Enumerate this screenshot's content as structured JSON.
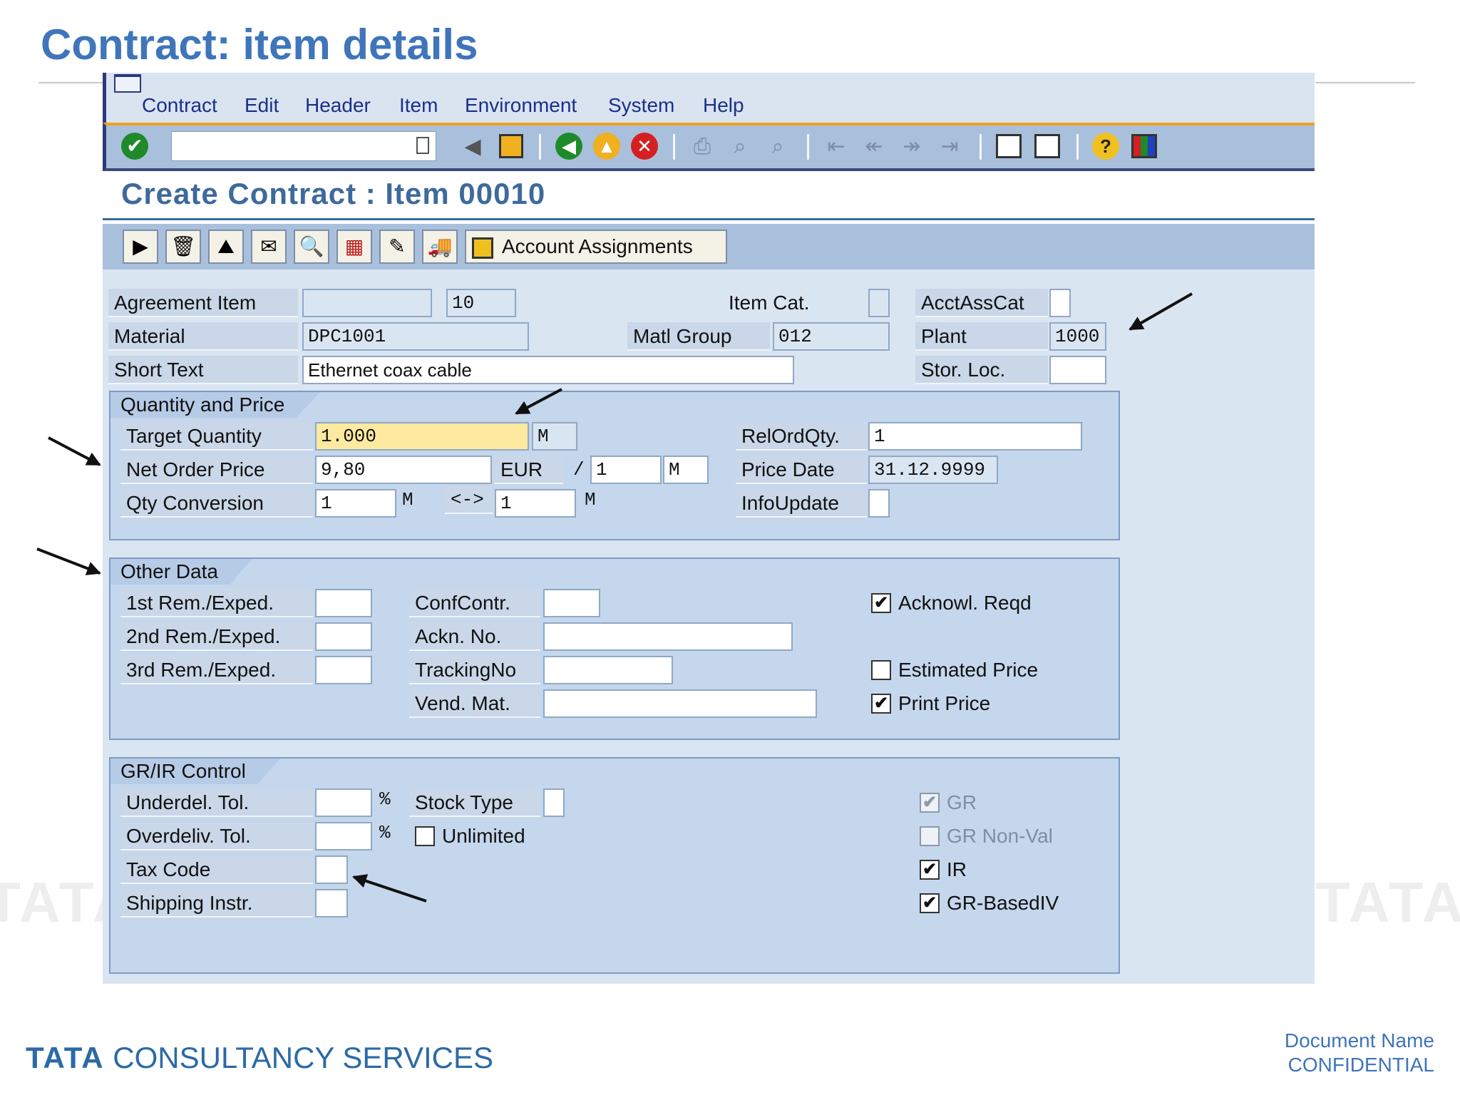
{
  "slide_title": "Contract: item details",
  "menu": [
    "Contract",
    "Edit",
    "Header",
    "Item",
    "Environment",
    "System",
    "Help"
  ],
  "toolbar_icons": [
    "enter-icon",
    "back-icon",
    "save-icon",
    "back-nav-icon",
    "exit-icon",
    "cancel-icon",
    "print-icon",
    "find-icon",
    "find-next-icon",
    "first-page-icon",
    "prev-page-icon",
    "next-page-icon",
    "last-page-icon",
    "new-session-icon",
    "shortcut-icon",
    "help-icon",
    "layout-icon"
  ],
  "screen_title": "Create Contract : Item 00010",
  "app_toolbar": {
    "account_assignments": "Account Assignments"
  },
  "header_fields": {
    "agreement_item": {
      "label": "Agreement Item",
      "value": "",
      "item_no": "10"
    },
    "item_cat": {
      "label": "Item Cat.",
      "value": ""
    },
    "acct_ass_cat": {
      "label": "AcctAssCat",
      "value": ""
    },
    "material": {
      "label": "Material",
      "value": "DPC1001"
    },
    "matl_group": {
      "label": "Matl Group",
      "value": "012"
    },
    "plant": {
      "label": "Plant",
      "value": "1000"
    },
    "short_text": {
      "label": "Short Text",
      "value": "Ethernet coax cable"
    },
    "stor_loc": {
      "label": "Stor. Loc.",
      "value": ""
    }
  },
  "quantity_price": {
    "title": "Quantity and Price",
    "target_quantity": {
      "label": "Target Quantity",
      "value": "1.000",
      "unit": "M"
    },
    "net_order_price": {
      "label": "Net Order Price",
      "value": "9,80",
      "currency": "EUR",
      "per": "1",
      "per_unit": "M",
      "slash": "/"
    },
    "qty_conversion": {
      "label": "Qty Conversion",
      "value1": "1",
      "unit1": "M",
      "arrow": "<->",
      "value2": "1",
      "unit2": "M"
    },
    "rel_ord_qty": {
      "label": "RelOrdQty.",
      "value": "1"
    },
    "price_date": {
      "label": "Price Date",
      "value": "31.12.9999"
    },
    "info_update": {
      "label": "InfoUpdate",
      "value": ""
    }
  },
  "other_data": {
    "title": "Other Data",
    "rem1": {
      "label": "1st Rem./Exped.",
      "value": ""
    },
    "rem2": {
      "label": "2nd Rem./Exped.",
      "value": ""
    },
    "rem3": {
      "label": "3rd Rem./Exped.",
      "value": ""
    },
    "conf_contr": {
      "label": "ConfContr.",
      "value": ""
    },
    "ackn_no": {
      "label": "Ackn. No.",
      "value": ""
    },
    "tracking_no": {
      "label": "TrackingNo",
      "value": ""
    },
    "vend_mat": {
      "label": "Vend. Mat.",
      "value": ""
    },
    "acknowl_reqd": {
      "label": "Acknowl. Reqd",
      "checked": true
    },
    "estimated_price": {
      "label": "Estimated Price",
      "checked": false
    },
    "print_price": {
      "label": "Print Price",
      "checked": true
    }
  },
  "grir_control": {
    "title": "GR/IR Control",
    "underdel_tol": {
      "label": "Underdel. Tol.",
      "value": "",
      "unit": "%"
    },
    "overdeliv_tol": {
      "label": "Overdeliv. Tol.",
      "value": "",
      "unit": "%"
    },
    "stock_type": {
      "label": "Stock Type",
      "value": ""
    },
    "unlimited": {
      "label": "Unlimited",
      "checked": false
    },
    "tax_code": {
      "label": "Tax Code",
      "value": ""
    },
    "shipping_instr": {
      "label": "Shipping Instr.",
      "value": ""
    },
    "gr": {
      "label": "GR",
      "checked": true,
      "disabled": true
    },
    "gr_non_val": {
      "label": "GR Non-Val",
      "checked": false,
      "disabled": true
    },
    "ir": {
      "label": "IR",
      "checked": true
    },
    "gr_based_iv": {
      "label": "GR-BasedIV",
      "checked": true
    }
  },
  "footer": {
    "brand_bold": "TATA",
    "brand_rest": "CONSULTANCY SERVICES",
    "doc_name": "Document Name",
    "confidential": "CONFIDENTIAL"
  },
  "watermark": "TATA",
  "check_mark": "✔",
  "colors": {
    "title_blue": "#3f75ba",
    "sap_bg": "#dae5f2",
    "highlight_field": "#fdeaa0"
  }
}
